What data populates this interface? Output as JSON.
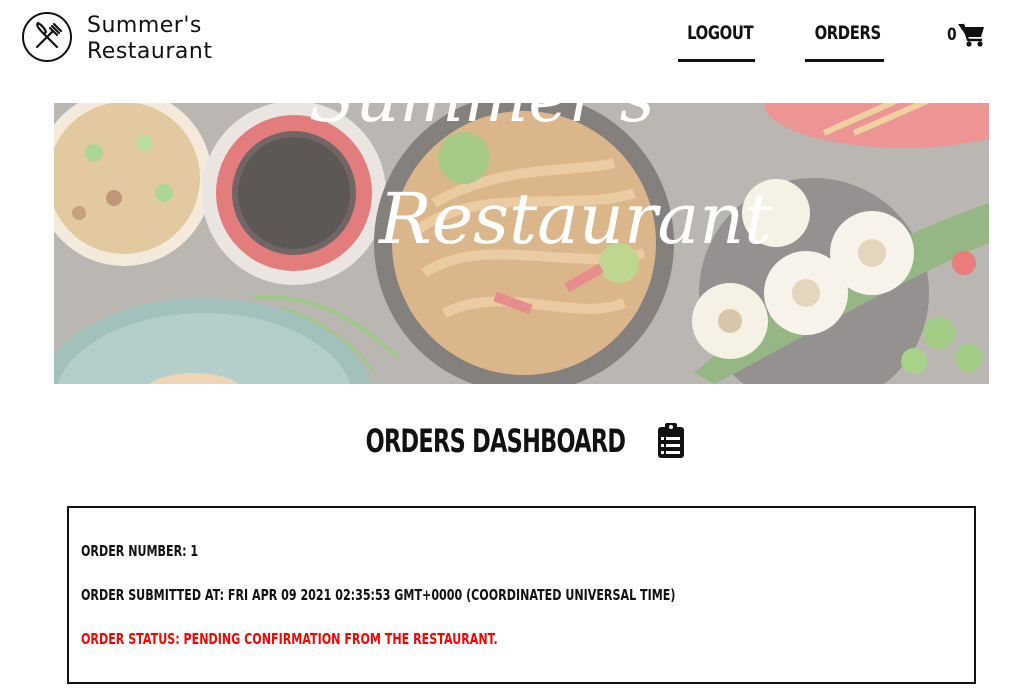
{
  "brand": {
    "name_line1": "Summer's",
    "name_line2": "Restaurant"
  },
  "nav": {
    "logout_label": "LOGOUT",
    "orders_label": "ORDERS",
    "cart_count": "0"
  },
  "banner": {
    "script_text_top": "Summer's",
    "script_text_bottom": "Restaurant"
  },
  "dashboard": {
    "title": "ORDERS DASHBOARD",
    "icon": "clipboard-list-icon"
  },
  "order": {
    "number_line": "Order Number: 1",
    "submitted_line": "Order Submitted at: Fri Apr 09 2021 02:35:53 GMT+0000 (Coordinated Universal Time)",
    "status_line": "Order Status: Pending confirmation from the restaurant."
  },
  "colors": {
    "text": "#111111",
    "status": "#ff0000",
    "background": "#ffffff"
  }
}
